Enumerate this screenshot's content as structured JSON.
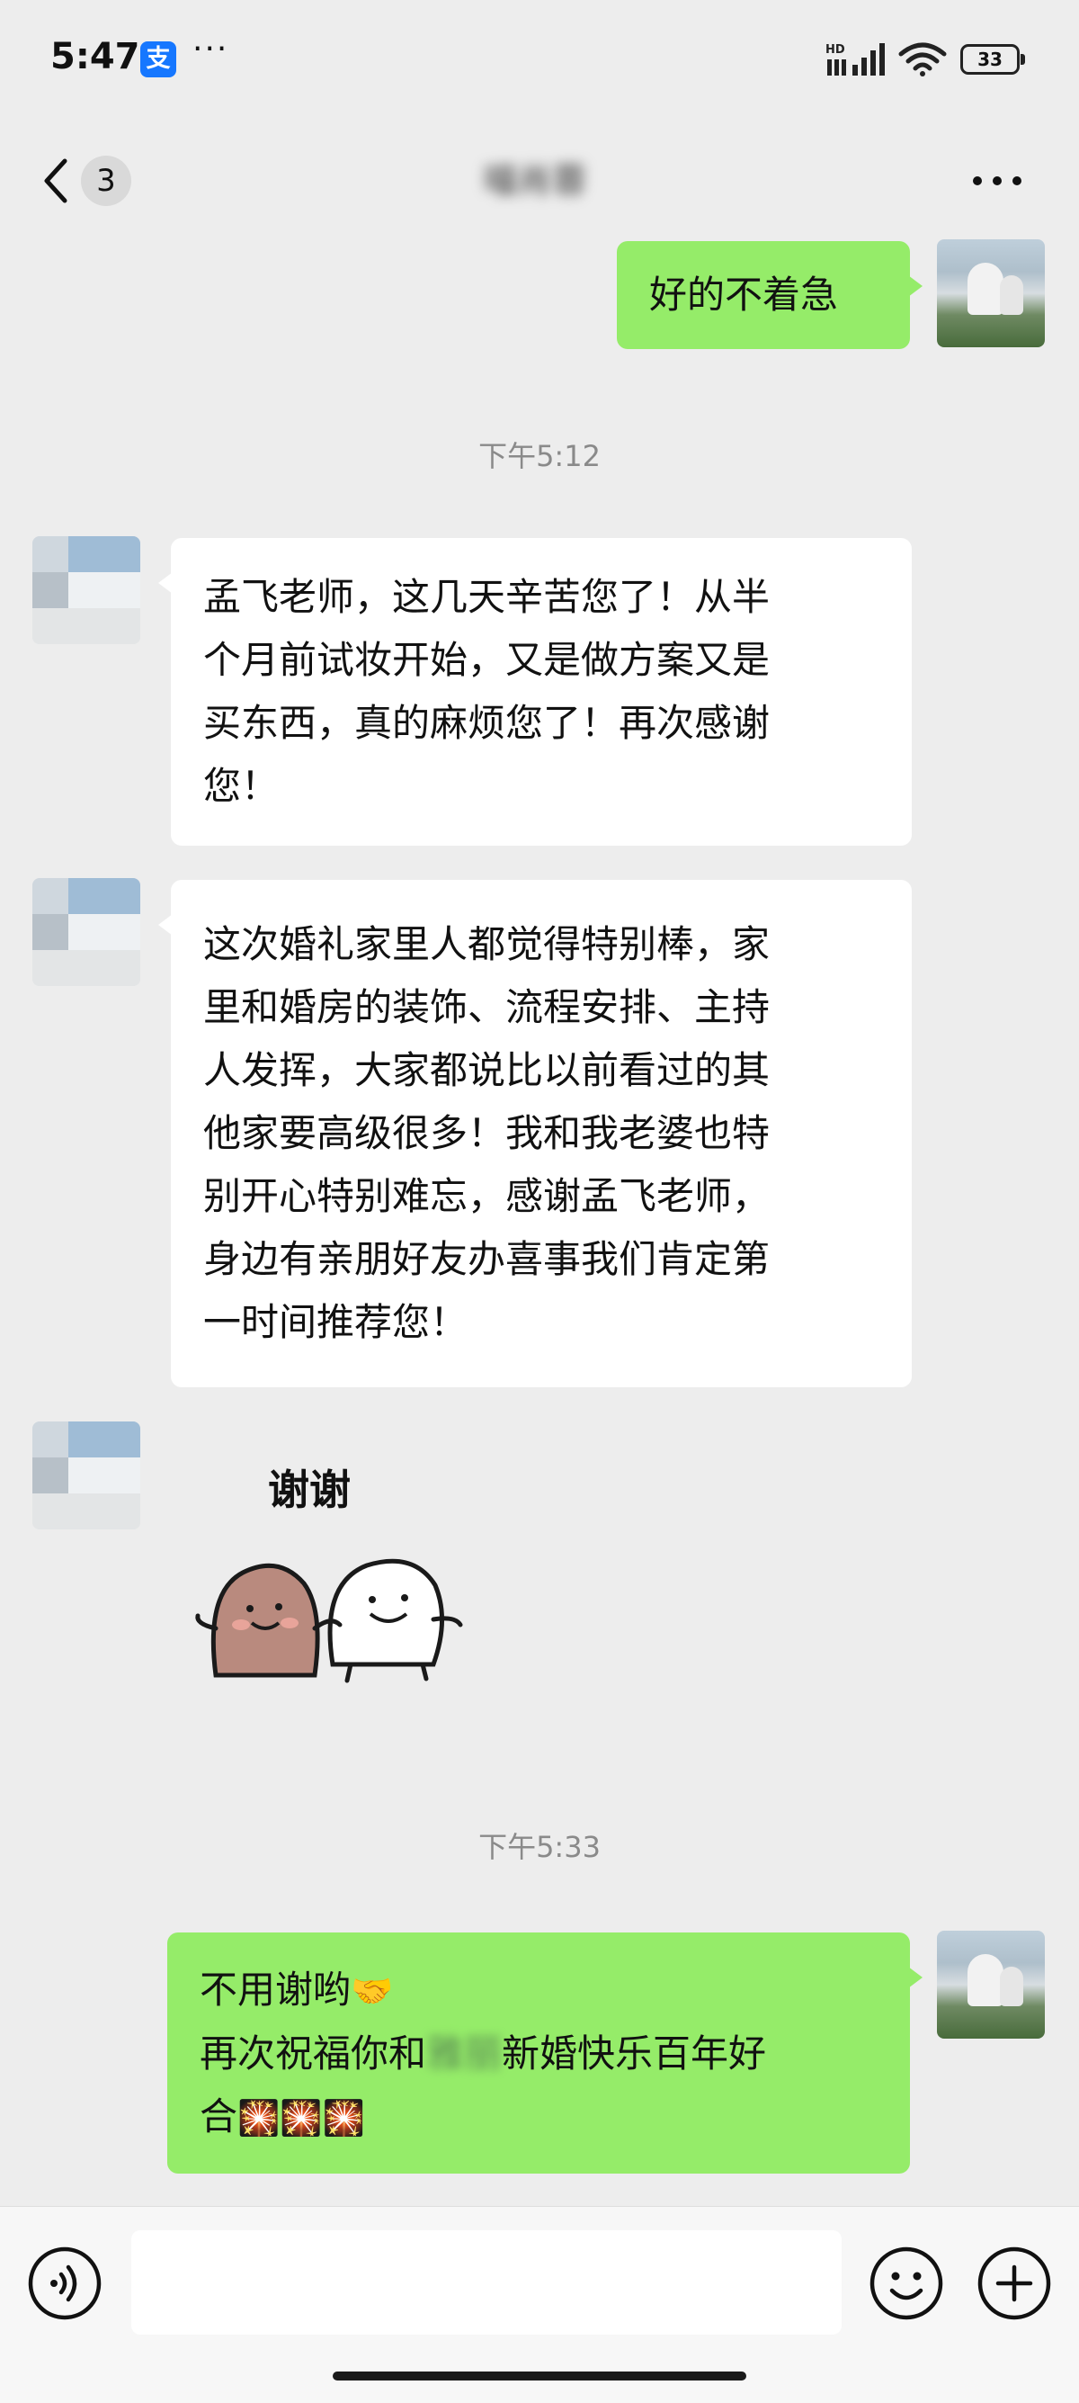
{
  "status_bar": {
    "time": "5:47",
    "app_badge": "支",
    "more": "···",
    "network": "HD",
    "battery": "33"
  },
  "header": {
    "back_count": "3",
    "title": "喵肖蓉"
  },
  "messages": [
    {
      "side": "me",
      "lines": [
        "好的不着急"
      ]
    },
    {
      "timestamp": "下午5:12"
    },
    {
      "side": "other",
      "lines": [
        "孟飞老师，这几天辛苦您了！从半",
        "个月前试妆开始，又是做方案又是",
        "买东西，真的麻烦您了！再次感谢",
        "您！"
      ]
    },
    {
      "side": "other",
      "lines": [
        "这次婚礼家里人都觉得特别棒，家",
        "里和婚房的装饰、流程安排、主持",
        "人发挥，大家都说比以前看过的其",
        "他家要高级很多！我和我老婆也特",
        "别开心特别难忘，感谢孟飞老师，",
        "身边有亲朋好友办喜事我们肯定第",
        "一时间推荐您！"
      ]
    },
    {
      "side": "other",
      "sticker_text": "谢谢"
    },
    {
      "timestamp": "下午5:33"
    },
    {
      "side": "me",
      "line1": "不用谢哟",
      "line2_pre": "再次祝福你和",
      "line2_blur": "雅丽",
      "line2_post": "新婚快乐百年好",
      "line3": "合"
    }
  ],
  "icons": {
    "back": "chevron-left-icon",
    "more": "more-dots-icon",
    "voice": "voice-icon",
    "emoji": "smiley-icon",
    "plus": "plus-icon",
    "handshake": "🤝",
    "fireworks": "🎇"
  },
  "colors": {
    "background": "#ededed",
    "my_bubble": "#95ec69",
    "their_bubble": "#ffffff",
    "timestamp": "#8a8a8a"
  },
  "input": {
    "value": ""
  }
}
